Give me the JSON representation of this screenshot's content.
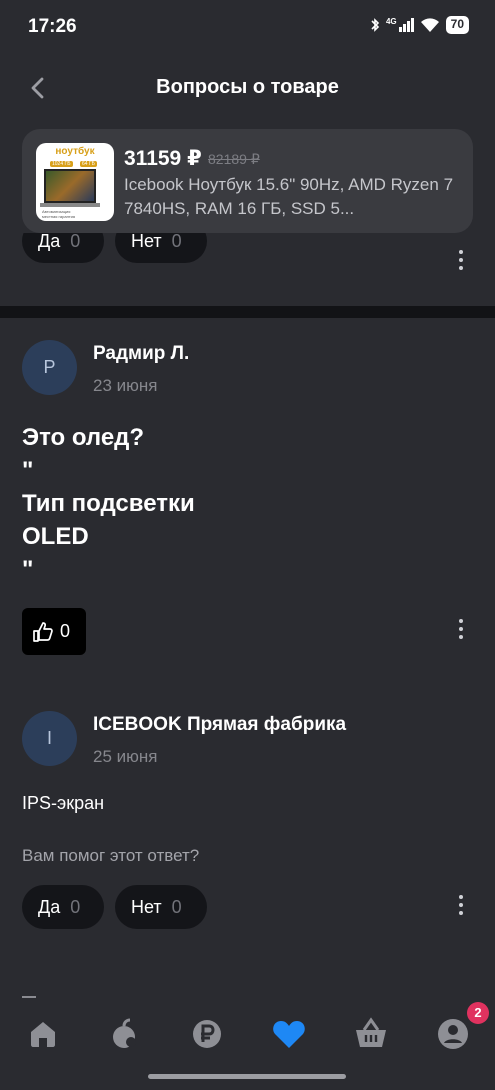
{
  "status_bar": {
    "time": "17:26",
    "network": "4G",
    "battery": "70"
  },
  "header": {
    "title": "Вопросы о товаре"
  },
  "product": {
    "price": "31159 ₽",
    "old_price": "82189 ₽",
    "name": "Icebook Ноутбук 15.6\" 90Hz, AMD Ryzen 7 7840HS, RAM 16 ГБ, SSD 5...",
    "thumb_label": "ноутбук",
    "thumb_chip_1": "1024 ГБ",
    "thumb_chip_2": "64 ГБ",
    "thumb_note_1": "Автоматизация",
    "thumb_note_2": "местная гарантия"
  },
  "top_feedback": {
    "yes_label": "Да",
    "yes_count": "0",
    "no_label": "Нет",
    "no_count": "0"
  },
  "question": {
    "avatar_letter": "Р",
    "author": "Радмир Л.",
    "date": "23 июня",
    "text": "Это олед?\n\"\nТип подсветки\nOLED\n\"",
    "likes": "0"
  },
  "answer": {
    "avatar_letter": "I",
    "author": "ICEBOOK Прямая фабрика",
    "date": "25 июня",
    "text": "IPS-экран",
    "helpful_prompt": "Вам помог этот ответ?",
    "yes_label": "Да",
    "yes_count": "0",
    "no_label": "Нет",
    "no_count": "0"
  },
  "bottom_nav": {
    "items": [
      "home-icon",
      "catalog-icon",
      "finance-icon",
      "favorites-icon",
      "cart-icon",
      "profile-icon"
    ],
    "active": "favorites-icon",
    "profile_badge": "2"
  },
  "colors": {
    "background": "#2a2b30",
    "card": "#3a3b40",
    "accent_blue": "#1e88f5",
    "badge": "#e0325f"
  }
}
